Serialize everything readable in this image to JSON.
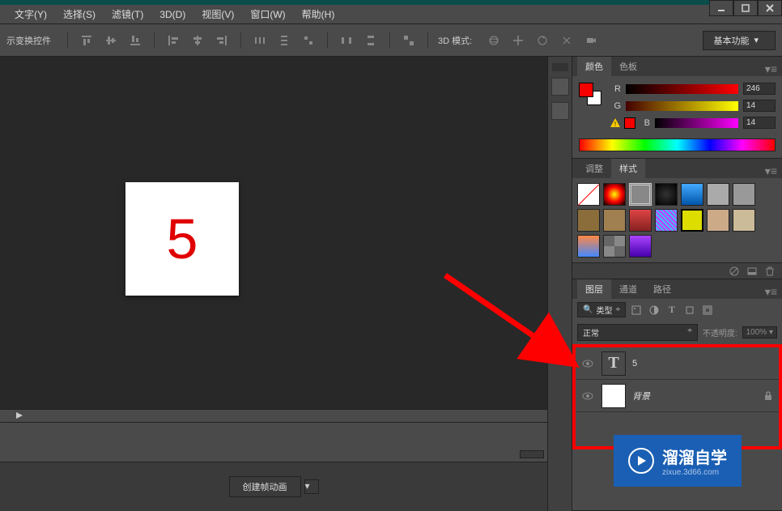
{
  "menu": {
    "text": "文字(Y)",
    "select": "选择(S)",
    "filter": "滤镜(T)",
    "3d": "3D(D)",
    "view": "视图(V)",
    "window": "窗口(W)",
    "help": "帮助(H)"
  },
  "window_controls": {
    "minimize": "minimize",
    "maximize": "maximize",
    "close": "close"
  },
  "options": {
    "transform_label": "示变换控件",
    "mode3d_label": "3D 模式:",
    "workspace": "基本功能"
  },
  "canvas": {
    "text": "5"
  },
  "timeline": {
    "create_btn": "创建帧动画"
  },
  "color_panel": {
    "tab_color": "颜色",
    "tab_swatches": "色板",
    "r_label": "R",
    "g_label": "G",
    "b_label": "B",
    "r_val": "246",
    "g_val": "14",
    "b_val": "14"
  },
  "styles_panel": {
    "tab_adjust": "调整",
    "tab_styles": "样式"
  },
  "layers_panel": {
    "tab_layers": "图层",
    "tab_channels": "通道",
    "tab_paths": "路径",
    "filter_label": "类型",
    "blend_mode": "正常",
    "opacity_label": "不透明度:",
    "opacity_val": "100%",
    "layer1_name": "5",
    "layer2_name": "背景"
  },
  "watermark": {
    "text": "溜溜自学",
    "sub": "zixue.3d66.com"
  }
}
